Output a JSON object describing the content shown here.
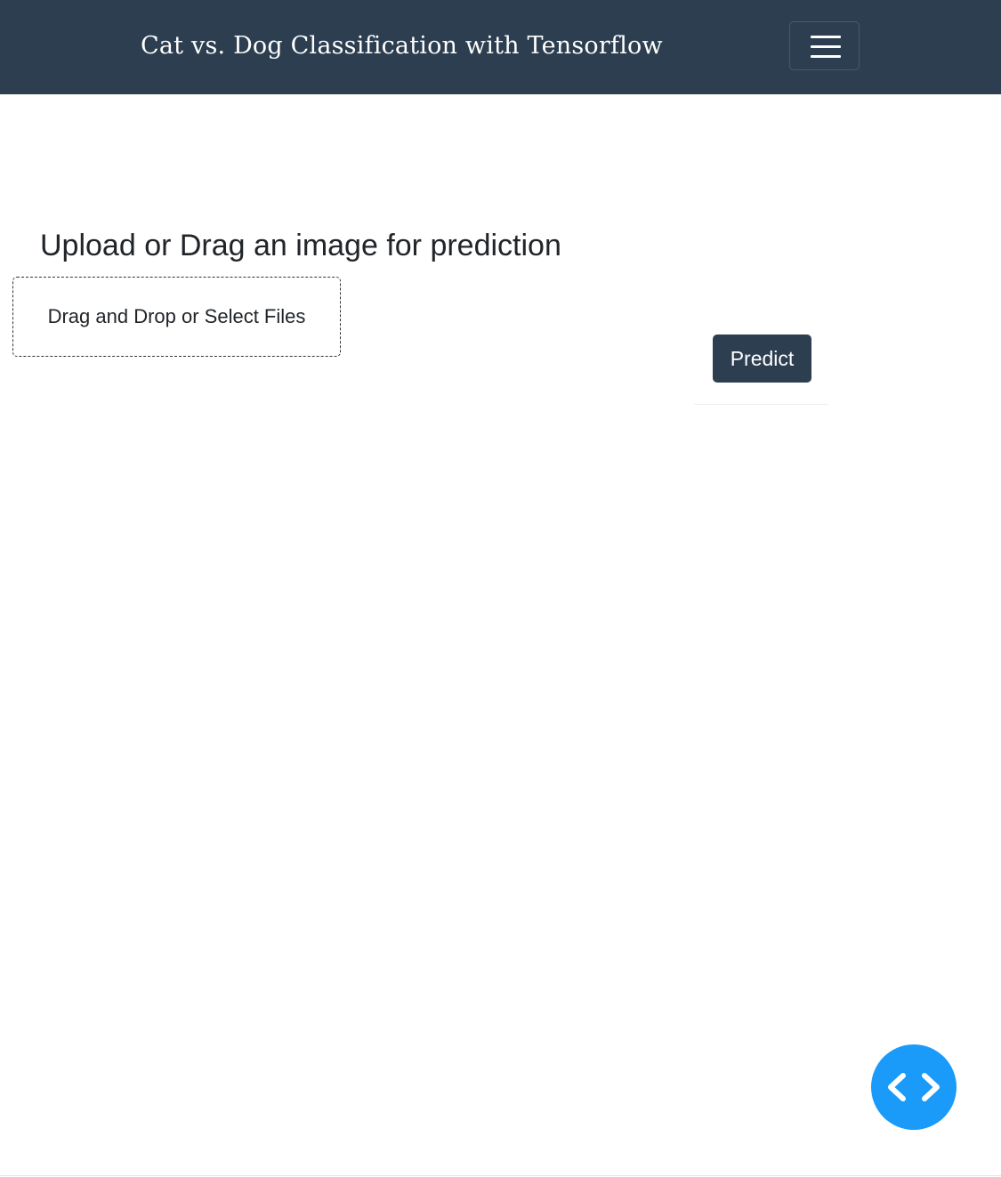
{
  "navbar": {
    "brand": "Cat vs. Dog Classification with Tensorflow",
    "toggler_icon": "hamburger-menu-icon",
    "background_color": "#2c3e50"
  },
  "main": {
    "heading": "Upload or Drag an image for prediction",
    "dropzone_label": "Drag and Drop or Select Files",
    "predict_label": "Predict"
  },
  "fab": {
    "icon": "code-icon",
    "color": "#1a9af9"
  }
}
